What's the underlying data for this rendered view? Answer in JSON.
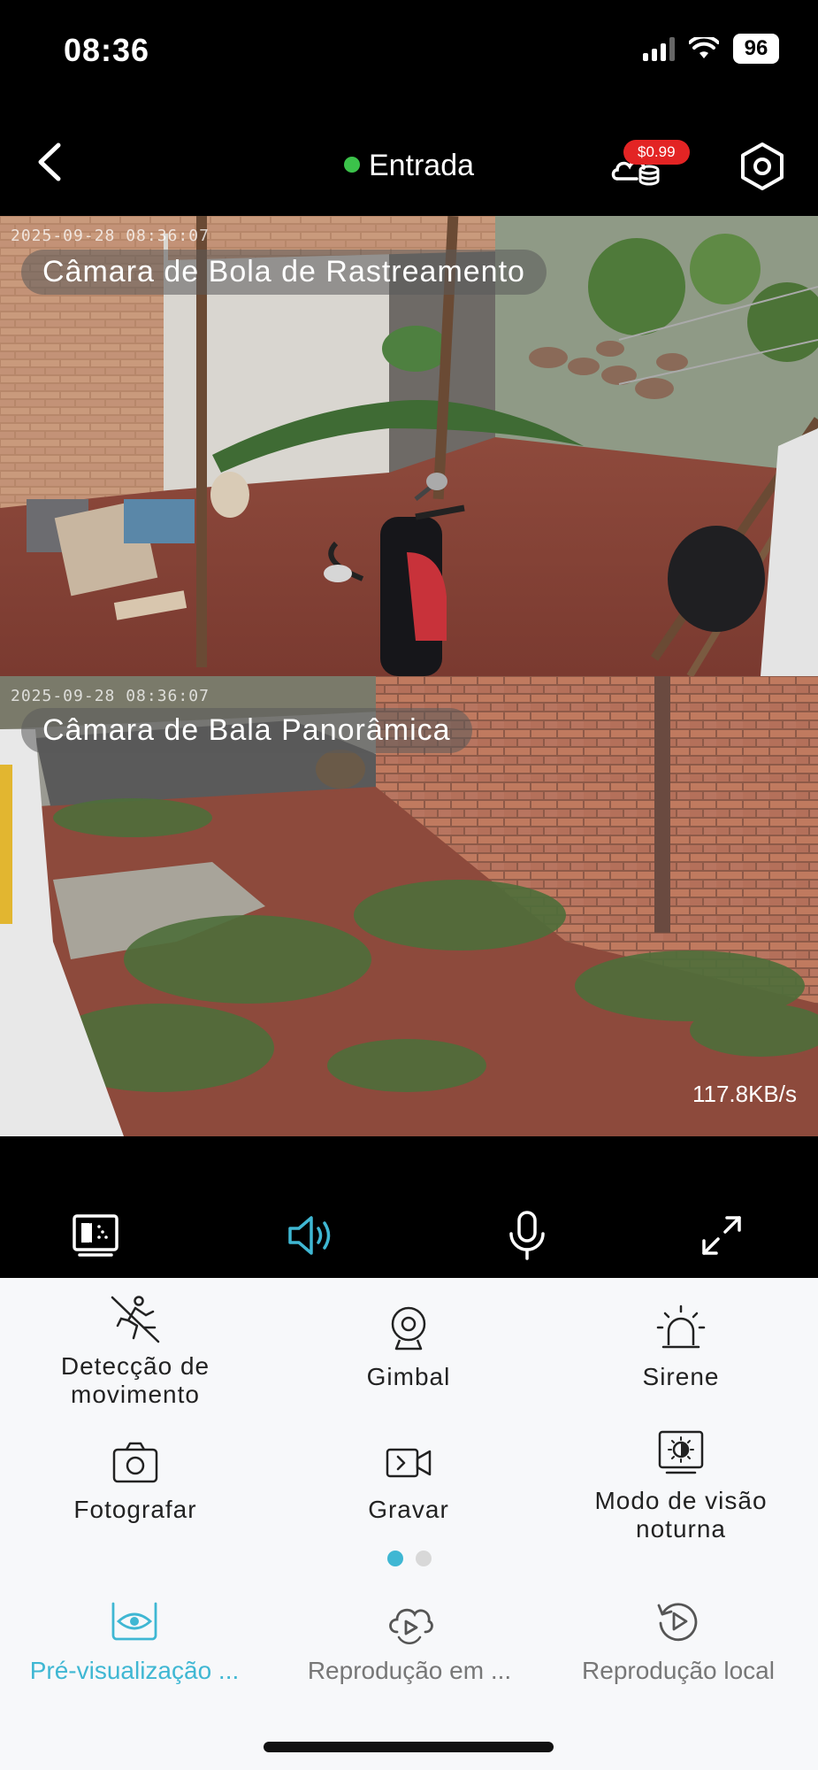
{
  "status_bar": {
    "time": "08:36",
    "battery": "96"
  },
  "header": {
    "title": "Entrada",
    "price": "$0.99",
    "colors": {
      "online": "#3bc24a",
      "badge": "#e32424"
    }
  },
  "feeds": [
    {
      "timestamp": "2025-09-28 08:36:07",
      "label": "Câmara de Bola de Rastreamento"
    },
    {
      "timestamp": "2025-09-28 08:36:07",
      "label": "Câmara de Bala Panorâmica",
      "speed": "117.8KB/s"
    }
  ],
  "controls": [
    {
      "icon": "picture-mode-icon"
    },
    {
      "icon": "speaker-icon",
      "active": true
    },
    {
      "icon": "microphone-icon"
    },
    {
      "icon": "fullscreen-icon"
    }
  ],
  "functions": {
    "motion": "Detecção de movimento",
    "gimbal": "Gimbal",
    "siren": "Sirene",
    "photo": "Fotografar",
    "record": "Gravar",
    "night": "Modo de visão noturna"
  },
  "pager": {
    "pages": 2,
    "current": 1
  },
  "tabs": {
    "preview": "Pré-visualização ...",
    "cloud": "Reprodução em ...",
    "local": "Reprodução local"
  },
  "accent_color": "#3fb7d3"
}
